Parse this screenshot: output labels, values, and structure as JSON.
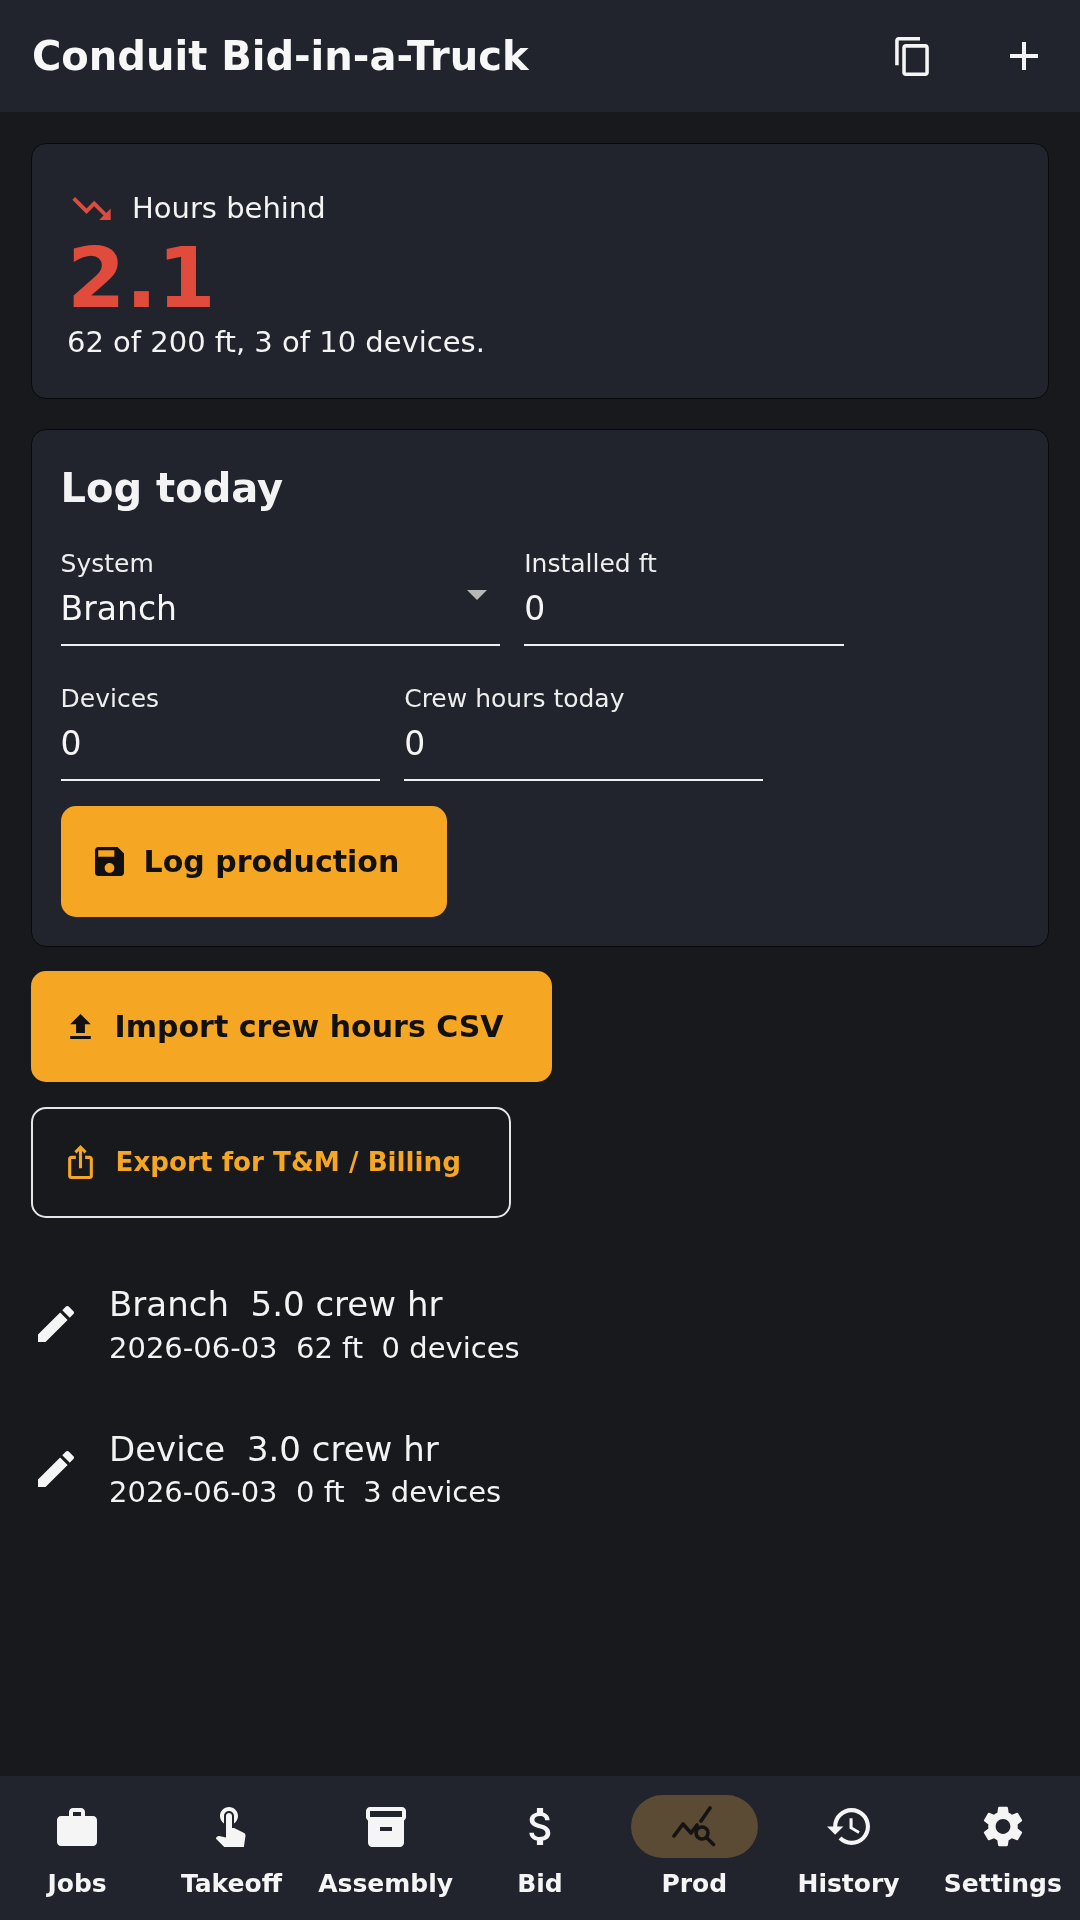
{
  "app_bar": {
    "title": "Conduit Bid-in-a-Truck"
  },
  "status_card": {
    "label": "Hours behind",
    "value": "2.1",
    "summary": "62 of 200 ft, 3 of 10 devices."
  },
  "log_form": {
    "title": "Log today",
    "fields": [
      {
        "kind": "select",
        "label": "System",
        "value": "Branch"
      },
      {
        "kind": "number",
        "label": "Installed ft",
        "value": "0"
      },
      {
        "kind": "number",
        "label": "Devices",
        "value": "0"
      },
      {
        "kind": "number",
        "label": "Crew hours today",
        "value": "0"
      }
    ],
    "submit": {
      "label": "Log production"
    }
  },
  "actions": [
    {
      "kind": "import",
      "label": "Import crew hours CSV"
    },
    {
      "kind": "export",
      "label": "Export for T&M / Billing"
    }
  ],
  "entries": [
    {
      "title": "Branch  5.0 crew hr",
      "details": "2026-06-03  62 ft  0 devices"
    },
    {
      "title": "Device  3.0 crew hr",
      "details": "2026-06-03  0 ft  3 devices"
    }
  ],
  "bottom_nav": [
    {
      "label": "Jobs",
      "selected": false
    },
    {
      "label": "Takeoff",
      "selected": false
    },
    {
      "label": "Assembly",
      "selected": false
    },
    {
      "label": "Bid",
      "selected": false
    },
    {
      "label": "Prod",
      "selected": true
    },
    {
      "label": "History",
      "selected": false
    },
    {
      "label": "Settings",
      "selected": false
    }
  ]
}
